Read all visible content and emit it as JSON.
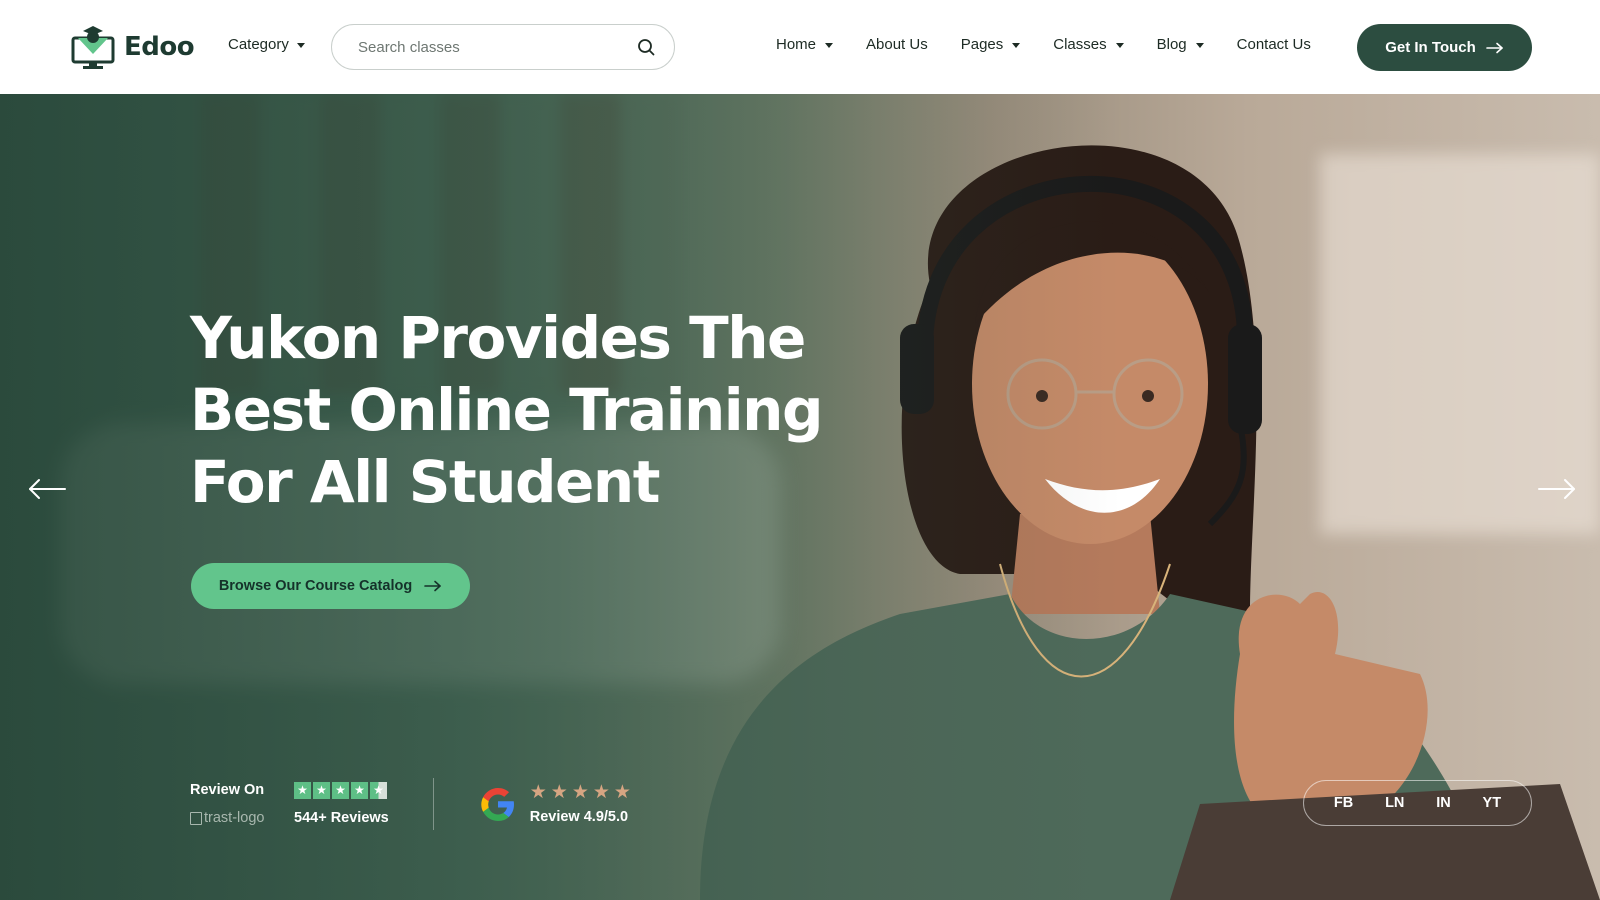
{
  "brand": {
    "name": "Edoo",
    "logo_icon": "graduate-monitor-icon"
  },
  "header": {
    "category_label": "Category",
    "search": {
      "placeholder": "Search classes",
      "value": ""
    },
    "nav": [
      {
        "label": "Home",
        "has_dropdown": true
      },
      {
        "label": "About Us",
        "has_dropdown": false
      },
      {
        "label": "Pages",
        "has_dropdown": true
      },
      {
        "label": "Classes",
        "has_dropdown": true
      },
      {
        "label": "Blog",
        "has_dropdown": true
      },
      {
        "label": "Contact Us",
        "has_dropdown": false
      }
    ],
    "cta_label": "Get In Touch"
  },
  "hero": {
    "headline_lines": [
      "Yukon Provides The",
      "Best Online Training",
      "For All Student"
    ],
    "cta_label": "Browse Our Course Catalog",
    "reviews": {
      "trust": {
        "label": "Review On",
        "logo_alt": "trast-logo",
        "count": "544+ Reviews",
        "stars": 4.5
      },
      "google": {
        "score": "Review 4.9/5.0",
        "stars": 5
      }
    },
    "social": [
      "FB",
      "LN",
      "IN",
      "YT"
    ]
  },
  "colors": {
    "primary_dark": "#2c4d40",
    "accent_green": "#62c58c",
    "star_tan": "#d6a582",
    "text_dark": "#1d2b24"
  }
}
